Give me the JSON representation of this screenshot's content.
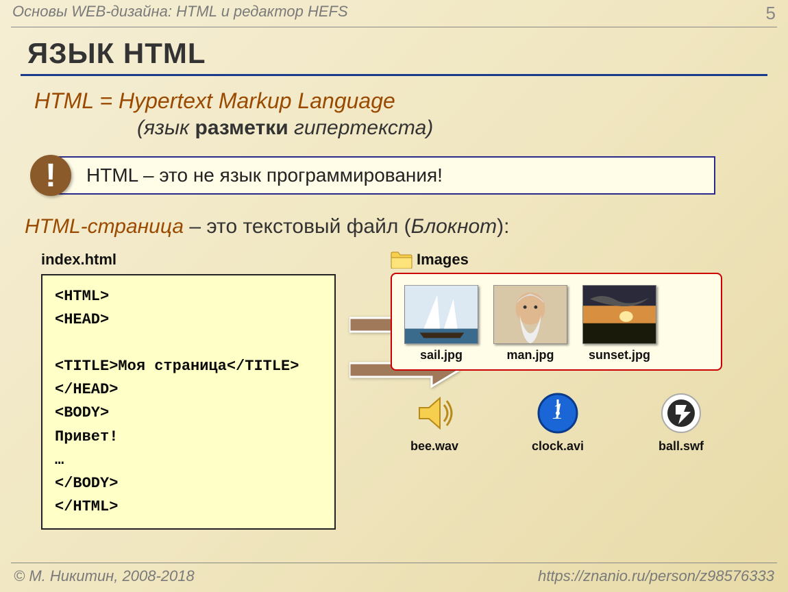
{
  "topbar": {
    "left": "Основы WEB-дизайна: HTML и редактор HEFS",
    "page": "5"
  },
  "heading": "Язык HTML",
  "definition": {
    "line1": "HTML = Hypertext Markup Language",
    "sub_pre": "(язык ",
    "sub_bold": "разметки",
    "sub_post": " гипертекста)"
  },
  "warning": {
    "badge": "!",
    "text": "HTML – это не язык программирования!"
  },
  "page_desc": {
    "term": "HTML-страница",
    "middle": " – это текстовый файл (",
    "paren": "Блокнот",
    "end": "):"
  },
  "code": {
    "filename": "index.html",
    "body": "<HTML>\n<HEAD>\n\n<TITLE>Моя страница</TITLE>\n</HEAD>\n<BODY>\nПривет!\n…\n</BODY>\n</HTML>"
  },
  "images_folder": "Images",
  "thumbs": [
    {
      "caption": "sail.jpg"
    },
    {
      "caption": "man.jpg"
    },
    {
      "caption": "sunset.jpg"
    }
  ],
  "assets": [
    {
      "caption": "bee.wav"
    },
    {
      "caption": "clock.avi"
    },
    {
      "caption": "ball.swf"
    }
  ],
  "footer": {
    "left": "© М. Никитин, 2008-2018",
    "right": "https://znanio.ru/person/z98576333"
  }
}
